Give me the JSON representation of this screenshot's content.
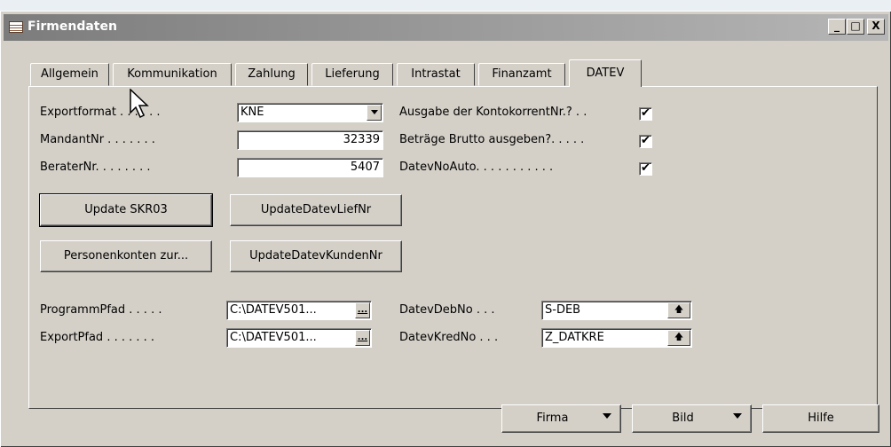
{
  "window": {
    "title": "Firmendaten"
  },
  "titlebar_buttons": {
    "minimize": "_",
    "maximize": "□",
    "close": "X"
  },
  "tabs": [
    {
      "label": "Allgemein"
    },
    {
      "label": "Kommunikation"
    },
    {
      "label": "Zahlung"
    },
    {
      "label": "Lieferung"
    },
    {
      "label": "Intrastat"
    },
    {
      "label": "Finanzamt"
    },
    {
      "label": "DATEV",
      "active": true
    }
  ],
  "fields": {
    "exportformat": {
      "label": "Exportformat . . . . . .",
      "value": "KNE"
    },
    "mandantnr": {
      "label": "MandantNr . . . . . . .",
      "value": "32339"
    },
    "beraternr": {
      "label": "BeraterNr. . . . . . . .",
      "value": "5407"
    },
    "ausgabe_kontokorrent": {
      "label": "Ausgabe der KontokorrentNr.? . .",
      "checked": true
    },
    "betraege_brutto": {
      "label": "Beträge Brutto ausgeben?. . . . .",
      "checked": true
    },
    "datev_no_auto": {
      "label": "DatevNoAuto. . . . . . . . . . .",
      "checked": true
    },
    "programm_pfad": {
      "label": "ProgrammPfad . . . . .",
      "value": "C:\\DATEV501..."
    },
    "export_pfad": {
      "label": "ExportPfad . . . . . . .",
      "value": "C:\\DATEV501..."
    },
    "datev_deb_no": {
      "label": "DatevDebNo . . .",
      "value": "S-DEB"
    },
    "datev_kred_no": {
      "label": "DatevKredNo . . .",
      "value": "Z_DATKRE"
    }
  },
  "buttons": {
    "update_skr03": "Update SKR03",
    "update_datev_lief": "UpdateDatevLiefNr",
    "personenkonten": "Personenkonten zur...",
    "update_datev_kunden": "UpdateDatevKundenNr",
    "ellipsis": "...",
    "up_arrow": "🡅",
    "check_mark": "✔",
    "firma": "Firma",
    "bild": "Bild",
    "hilfe": "Hilfe"
  },
  "icons": {
    "app": "table-icon",
    "dropdown": "chevron-down-icon",
    "lookup": "ellipsis-icon",
    "up": "arrow-up-icon",
    "cursor": "mouse-pointer-icon"
  }
}
